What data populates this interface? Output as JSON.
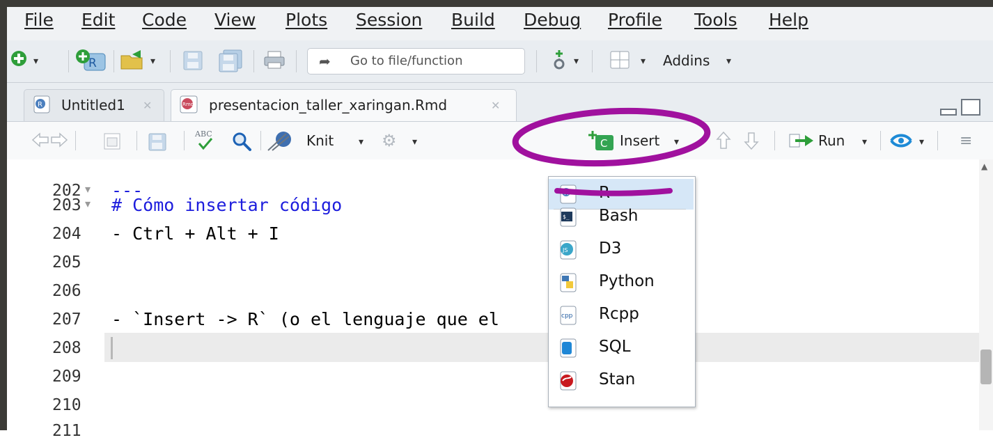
{
  "menubar": {
    "items": [
      {
        "label": "File"
      },
      {
        "label": "Edit"
      },
      {
        "label": "Code"
      },
      {
        "label": "View"
      },
      {
        "label": "Plots"
      },
      {
        "label": "Session"
      },
      {
        "label": "Build"
      },
      {
        "label": "Debug"
      },
      {
        "label": "Profile"
      },
      {
        "label": "Tools"
      },
      {
        "label": "Help"
      }
    ]
  },
  "toolbar": {
    "goto_placeholder": "Go to file/function",
    "addins_label": "Addins"
  },
  "tabs": [
    {
      "label": "Untitled1",
      "icon": "r-script-icon",
      "active": false
    },
    {
      "label": "presentacion_taller_xaringan.Rmd",
      "icon": "rmd-icon",
      "active": true
    }
  ],
  "editor_toolbar": {
    "knit_label": "Knit",
    "insert_label": "Insert",
    "run_label": "Run"
  },
  "editor": {
    "lines": [
      {
        "num": "202",
        "fold": "▾",
        "text": "---"
      },
      {
        "num": "203",
        "fold": "▾",
        "text": "# Cómo insertar código"
      },
      {
        "num": "204",
        "fold": "",
        "text": "- Ctrl + Alt + I"
      },
      {
        "num": "205",
        "fold": "",
        "text": ""
      },
      {
        "num": "206",
        "fold": "",
        "text": ""
      },
      {
        "num": "207",
        "fold": "",
        "text": "- `Insert -> R` (o el lenguaje que el"
      },
      {
        "num": "208",
        "fold": "",
        "text": ""
      },
      {
        "num": "209",
        "fold": "",
        "text": ""
      },
      {
        "num": "210",
        "fold": "",
        "text": ""
      },
      {
        "num": "211",
        "fold": "",
        "text": ""
      }
    ]
  },
  "insert_menu": {
    "items": [
      {
        "label": "R",
        "icon": "r-chunk-icon",
        "highlighted": true
      },
      {
        "label": "Bash",
        "icon": "bash-icon"
      },
      {
        "label": "D3",
        "icon": "d3-icon"
      },
      {
        "label": "Python",
        "icon": "python-icon"
      },
      {
        "label": "Rcpp",
        "icon": "rcpp-icon"
      },
      {
        "label": "SQL",
        "icon": "sql-icon"
      },
      {
        "label": "Stan",
        "icon": "stan-icon"
      }
    ]
  },
  "colors": {
    "annotation": "#a0119e",
    "menu_highlight": "#d6e7f7",
    "editor_blue": "#1d1ddd"
  }
}
